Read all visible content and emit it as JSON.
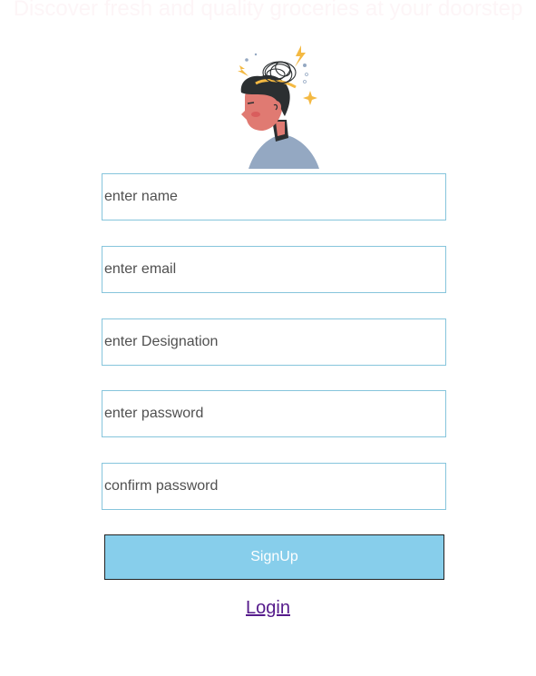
{
  "header": {
    "tagline": "Discover fresh and quality groceries at your doorstep"
  },
  "illustration": {
    "icon": "confused-person-icon"
  },
  "form": {
    "name_placeholder": "enter name",
    "email_placeholder": "enter email",
    "designation_placeholder": "enter Designation",
    "password_placeholder": "enter password",
    "confirm_password_placeholder": "confirm password",
    "signup_label": "SignUp"
  },
  "footer": {
    "login_label": "Login"
  },
  "colors": {
    "button_bg": "#87ceeb",
    "field_border": "#86c5dc",
    "link": "#551a8b"
  }
}
